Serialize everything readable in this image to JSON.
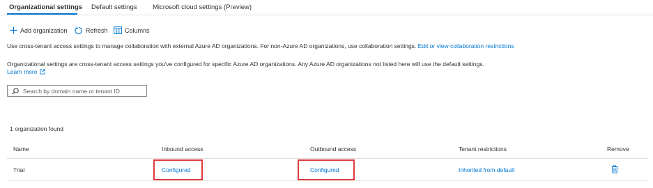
{
  "tabs": [
    {
      "label": "Organizational settings",
      "active": true
    },
    {
      "label": "Default settings",
      "active": false
    },
    {
      "label": "Microsoft cloud settings (Preview)",
      "active": false
    }
  ],
  "toolbar": {
    "add_label": "Add organization",
    "refresh_label": "Refresh",
    "columns_label": "Columns"
  },
  "intro": {
    "text": "Use cross-tenant access settings to manage collaboration with external Azure AD organizations. For non-Azure AD organizations, use collaboration settings.",
    "link": "Edit or view collaboration restrictions"
  },
  "info": {
    "text": "Organizational settings are cross-tenant access settings you've configured for specific Azure AD organizations. Any Azure AD organizations not listed here will use the default settings.",
    "learn_more": "Learn more"
  },
  "search": {
    "placeholder": "Search by domain name or tenant ID",
    "value": ""
  },
  "results": {
    "count_text": "1 organization found"
  },
  "table": {
    "headers": [
      "Name",
      "Inbound access",
      "Outbound access",
      "Tenant restrictions",
      "Remove"
    ],
    "rows": [
      {
        "name": "Trial",
        "inbound": "Configured",
        "outbound": "Configured",
        "tenant_restrictions": "Inherited from default",
        "remove_icon": "trash-icon"
      }
    ]
  },
  "colors": {
    "accent": "#0078d4",
    "highlight": "#e03b3b",
    "text": "#323130"
  }
}
